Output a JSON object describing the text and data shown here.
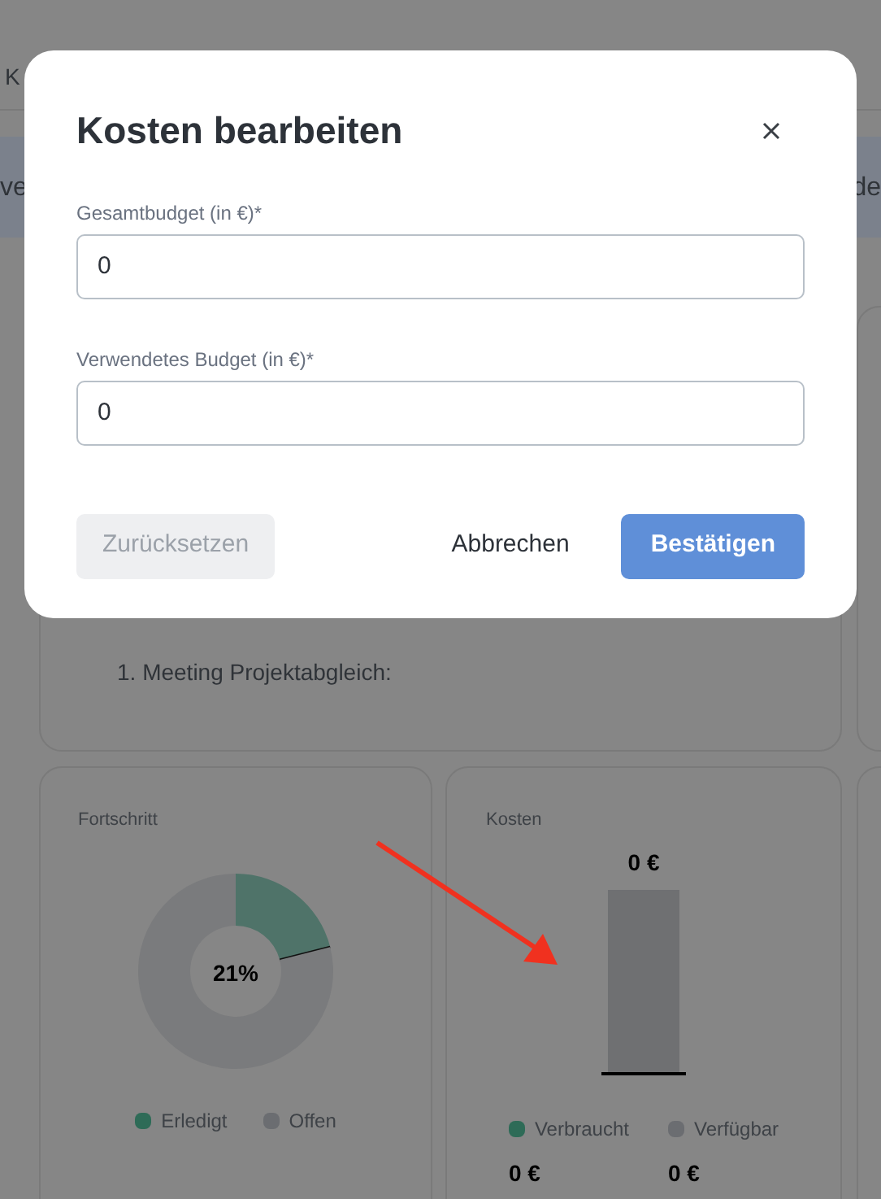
{
  "background": {
    "tab_fragment": "K",
    "band_left_fragment": "ve",
    "band_right_fragment": "de",
    "notes_item": "1. Meeting Projektabgleich:"
  },
  "progress_card": {
    "title": "Fortschritt",
    "center_label": "21%",
    "chart_data": {
      "type": "donut",
      "categories": [
        "Erledigt",
        "Offen"
      ],
      "values": [
        21,
        79
      ]
    },
    "legend": [
      {
        "color": "#2e6b57"
      },
      {
        "color": "#6b6d71"
      }
    ]
  },
  "costs_card": {
    "title": "Kosten",
    "bar_label": "0 €",
    "legend": [
      {
        "label": "Verbraucht",
        "color": "#2e6b57",
        "value": "0 €"
      },
      {
        "label": "Verfügbar",
        "color": "#6b6d71",
        "value": "0 €"
      }
    ]
  },
  "modal": {
    "title": "Kosten bearbeiten",
    "fields": [
      {
        "label": "Gesamtbudget (in €)*",
        "value": "0"
      },
      {
        "label": "Verwendetes Budget (in €)*",
        "value": "0"
      }
    ],
    "buttons": [
      {
        "kind": "secondary",
        "label": "Zurücksetzen",
        "disabled": true
      },
      {
        "kind": "plain",
        "label": "Abbrechen",
        "disabled": false
      },
      {
        "kind": "primary",
        "label": "Bestätigen",
        "disabled": false
      }
    ]
  }
}
